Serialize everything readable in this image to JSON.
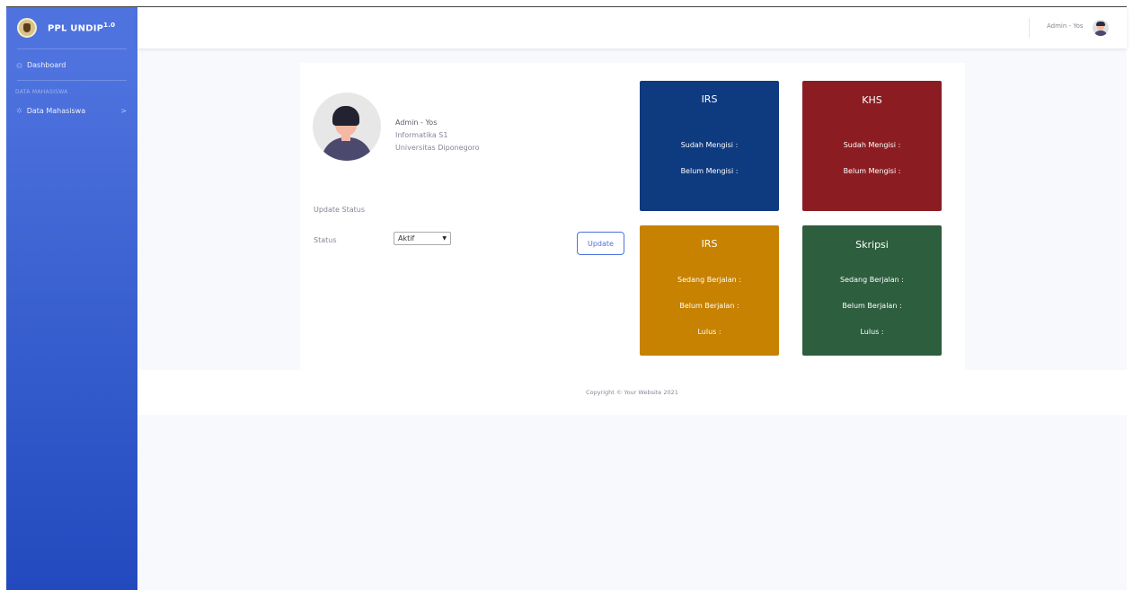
{
  "brand": {
    "name": "PPL UNDIP",
    "version": "1.0",
    "logo_icon": "university-seal-icon"
  },
  "sidebar": {
    "dashboard": {
      "label": "Dashboard",
      "icon": "tachometer-icon"
    },
    "heading": "DATA MAHASISWA",
    "data_mahasiswa": {
      "label": "Data Mahasiswa",
      "icon": "cog-icon"
    }
  },
  "topbar": {
    "user_name": "Admin - Yos"
  },
  "profile": {
    "name": "Admin - Yos",
    "prodi": "Informatika S1",
    "university": "Universitas Diponegoro"
  },
  "update_form": {
    "title": "Update Status",
    "status_label": "Status",
    "status_value": "Aktif",
    "button_label": "Update"
  },
  "cards": {
    "irs1": {
      "title": "IRS",
      "line1": "Sudah Mengisi :",
      "line2": "Belum Mengisi :",
      "color": "#0e3a7f"
    },
    "khs": {
      "title": "KHS",
      "line1": "Sudah Mengisi :",
      "line2": "Belum Mengisi :",
      "color": "#8b1d22"
    },
    "irs2": {
      "title": "IRS",
      "line1": "Sedang Berjalan :",
      "line2": "Belum Berjalan :",
      "line3": "Lulus :",
      "color": "#c68200"
    },
    "skripsi": {
      "title": "Skripsi",
      "line1": "Sedang Berjalan :",
      "line2": "Belum Berjalan :",
      "line3": "Lulus :",
      "color": "#2d5e3e"
    }
  },
  "footer": {
    "copyright": "Copyright © Your Website 2021"
  }
}
